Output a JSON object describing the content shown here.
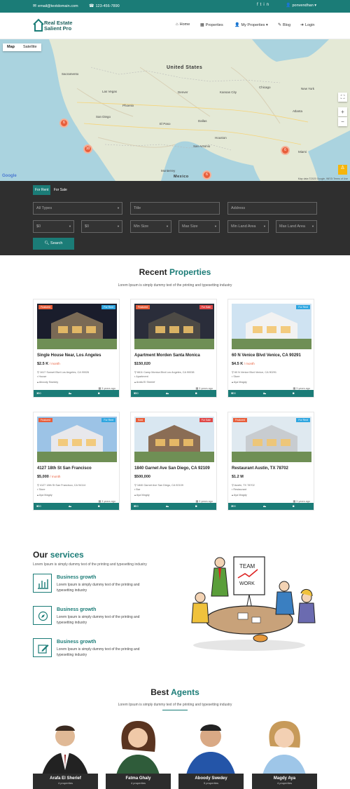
{
  "topbar": {
    "email": "email@textdomain.com",
    "phone": "123-456-7890",
    "social": [
      "facebook-icon",
      "twitter-icon",
      "linkedin-icon"
    ],
    "user": "ponvendhan"
  },
  "brand": {
    "line1": "Real Estate",
    "line2": "Salient Pro"
  },
  "nav": [
    {
      "label": "Home",
      "icon": "home-icon"
    },
    {
      "label": "Properties",
      "icon": "building-icon"
    },
    {
      "label": "My Properties",
      "icon": "user-icon"
    },
    {
      "label": "Blog",
      "icon": "edit-icon"
    },
    {
      "label": "Login",
      "icon": "login-icon"
    }
  ],
  "map": {
    "toggle": [
      "Map",
      "Satellite"
    ],
    "clusters": [
      "6",
      "10",
      "6",
      "6"
    ],
    "labels": {
      "country": "United States",
      "mexico": "Mexico",
      "attribution": "Map data ©2020 Google, INEGI    Terms of Use",
      "google": "Google"
    }
  },
  "search": {
    "tabs": [
      "For Rent",
      "For Sale"
    ],
    "fields": {
      "types": "All Types",
      "title": "Title",
      "address": "Address",
      "min_price": "$0",
      "max_price": "$0",
      "min_size": "Min Size",
      "max_size": "Max Size",
      "min_land": "Min Land Area",
      "max_land": "Max Land Area"
    },
    "button": "Search"
  },
  "recent": {
    "title_a": "Recent",
    "title_b": "Properties",
    "subtitle": "Lorem Ipsum is simply dummy text of the printing and typesetting industry",
    "cards": [
      {
        "tag1": "Featured",
        "tag2": "For Rent",
        "title": "Single House Near, Los Angeles",
        "price": "$2.5 K",
        "per": "/ month",
        "address": "1617 Sunset Blvd Los Angeles, CA 90026",
        "type": "House",
        "agent": "Aboody Swedey",
        "ago": "3 years ago",
        "size": "190 Sqft",
        "beds": "3",
        "baths": "2"
      },
      {
        "tag1": "Featured",
        "tag2": "For Sale",
        "title": "Apartment Morden Santa Monica",
        "price": "$150,020",
        "per": "",
        "address": "6611 Camp Monica Blvd Los Angeles, CA 90038",
        "type": "Apartment",
        "agent": "Arafa El Sherief",
        "ago": "3 years ago",
        "size": "530 Sqft",
        "beds": "4",
        "baths": "3"
      },
      {
        "tag1": "",
        "tag2": "For Rent",
        "title": "60 N Venice Blvd Venice, CA 90291",
        "price": "$4.5 K",
        "per": "/ month",
        "address": "60 N Venice Blvd Venice, CA 90291",
        "type": "Store",
        "agent": "Aya Magdy",
        "ago": "3 years ago",
        "size": "900 Sqft",
        "beds": "3",
        "baths": "2"
      },
      {
        "tag1": "Featured",
        "tag2": "For Rent",
        "title": "4127 18th St San Francisco",
        "price": "$5,000",
        "per": "/ month",
        "address": "4127 18th St San Francisco, CA 94114",
        "type": "Store",
        "agent": "Aya Magdy",
        "ago": "3 years ago",
        "size": "500 Sqft",
        "beds": "4",
        "baths": "3"
      },
      {
        "tag1": "Sold",
        "tag2": "For Sale",
        "title": "1840 Garnet Ave San Diego, CA 92109",
        "price": "$500,000",
        "per": "",
        "address": "1840 Garnet Ave San Diego, CA 92109",
        "type": "Bar",
        "agent": "Aya Magdy",
        "ago": "3 years ago",
        "size": "500 Sqft",
        "beds": "4",
        "baths": "3"
      },
      {
        "tag1": "Featured",
        "tag2": "For Rent",
        "title": "Restaurant Austin, TX 78702",
        "price": "$1.2 M",
        "per": "",
        "address": "Austin, TX 78702",
        "type": "Restaurant",
        "agent": "Aya Magdy",
        "ago": "3 years ago",
        "size": "200 Sqft",
        "beds": "4",
        "baths": "2"
      }
    ]
  },
  "services": {
    "title_a": "Our",
    "title_b": "services",
    "subtitle": "Lorem Ipsum is simply dummy text of the printing and typesetting industry",
    "items": [
      {
        "title": "Business growth",
        "text": "Lorem Ipsum is simply dummy text of the printing and typesetting industry",
        "icon": "chart-icon"
      },
      {
        "title": "Business growth",
        "text": "Lorem Ipsum is simply dummy text of the printing and typesetting industry",
        "icon": "compass-icon"
      },
      {
        "title": "Business growth",
        "text": "Lorem Ipsum is simply dummy text of the printing and typesetting industry",
        "icon": "edit-icon"
      }
    ],
    "illustration": {
      "board_line1": "TEAM",
      "board_line2": "WORK"
    }
  },
  "agents": {
    "title_a": "Best",
    "title_b": "Agents",
    "subtitle": "Lorem Ipsum is simply dummy text of the printing and typesetting industry",
    "list": [
      {
        "name": "Arafa El Sherief",
        "count": "4 properties"
      },
      {
        "name": "Fatma Ghaly",
        "count": "4 properties"
      },
      {
        "name": "Aboody Swedey",
        "count": "5 properties"
      },
      {
        "name": "Magdy Aya",
        "count": "4 properties"
      }
    ]
  },
  "colors": {
    "accent": "#1b7c77",
    "featured": "#e85e3b",
    "rent": "#2fa6e0",
    "sale": "#e04848",
    "dark": "#2f2f2f"
  }
}
